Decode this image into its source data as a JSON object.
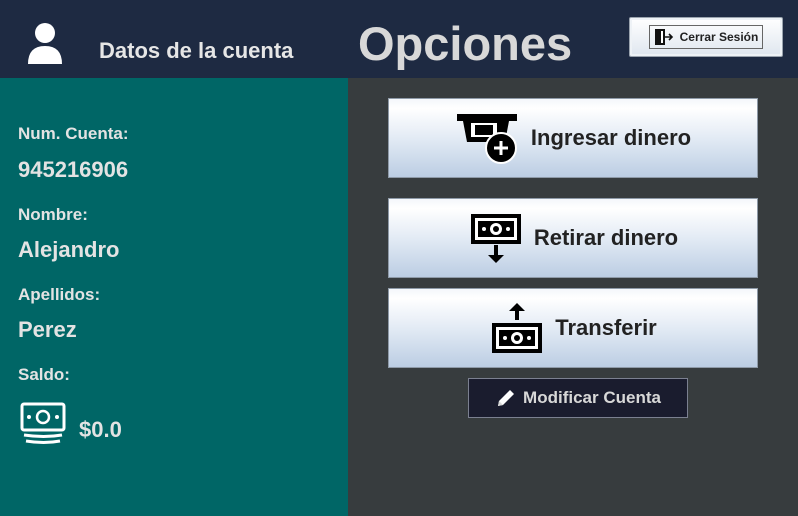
{
  "header": {
    "account_title": "Datos de la cuenta",
    "options_title": "Opciones",
    "logout_label": "Cerrar Sesión"
  },
  "sidebar": {
    "account_number_label": "Num. Cuenta:",
    "account_number": "945216906",
    "name_label": "Nombre:",
    "name": "Alejandro",
    "surname_label": "Apellidos:",
    "surname": "Perez",
    "balance_label": "Saldo:",
    "balance": "$0.0"
  },
  "actions": {
    "deposit_label": "Ingresar dinero",
    "withdraw_label": "Retirar dinero",
    "transfer_label": "Transferir",
    "modify_label": "Modificar Cuenta"
  },
  "icons": {
    "user": "user-icon",
    "logout": "logout-icon",
    "deposit": "atm-deposit-icon",
    "withdraw": "cash-withdraw-icon",
    "transfer": "cash-transfer-icon",
    "modify": "pencil-icon",
    "balance": "cash-stack-icon"
  },
  "colors": {
    "header_bg": "#1e2a42",
    "sidebar_bg": "#006666",
    "content_bg": "#373c3e",
    "modify_bg": "#1a1c2e"
  }
}
